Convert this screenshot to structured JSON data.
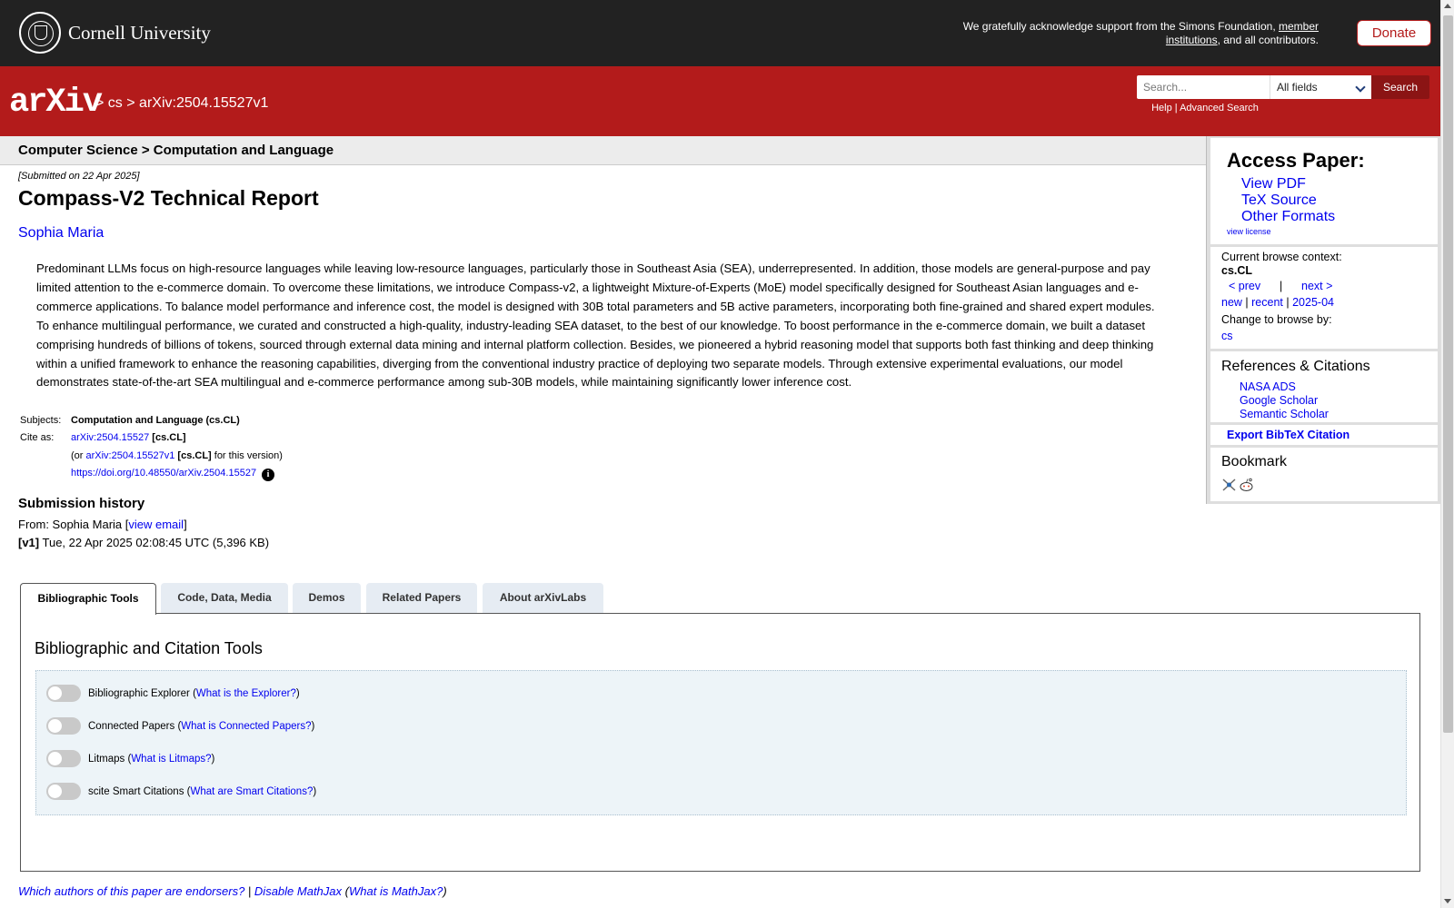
{
  "cornell": {
    "name": "Cornell University",
    "support_prefix": "We gratefully acknowledge support from the Simons Foundation, ",
    "support_link": "member institutions",
    "support_suffix": ", and all contributors.",
    "donate_label": "Donate"
  },
  "header": {
    "logo": "arXiv",
    "crumb_sep1": ">",
    "crumb_cs": "cs",
    "crumb_sep2": ">",
    "crumb_id": "arXiv:2504.15527v1",
    "search_placeholder": "Search...",
    "search_field": "All fields",
    "search_button": "Search",
    "help": "Help",
    "pipe": "|",
    "advanced": "Advanced Search"
  },
  "subheader": "Computer Science > Computation and Language",
  "paper": {
    "dateline": "[Submitted on 22 Apr 2025]",
    "title": "Compass-V2 Technical Report",
    "author": "Sophia Maria",
    "abstract": "Predominant LLMs focus on high-resource languages while leaving low-resource languages, particularly those in Southeast Asia (SEA), underrepresented. In addition, those models are general-purpose and pay limited attention to the e-commerce domain. To overcome these limitations, we introduce Compass-v2, a lightweight Mixture-of-Experts (MoE) model specifically designed for Southeast Asian languages and e-commerce applications. To balance model performance and inference cost, the model is designed with 30B total parameters and 5B active parameters, incorporating both fine-grained and shared expert modules. To enhance multilingual performance, we curated and constructed a high-quality, industry-leading SEA dataset, to the best of our knowledge. To boost performance in the e-commerce domain, we built a dataset comprising hundreds of billions of tokens, sourced through external data mining and internal platform collection. Besides, we pioneered a hybrid reasoning model that supports both fast thinking and deep thinking within a unified framework to enhance the reasoning capabilities, diverging from the conventional industry practice of deploying two separate models. Through extensive experimental evaluations, our model demonstrates state-of-the-art SEA multilingual and e-commerce performance among sub-30B models, while maintaining significantly lower inference cost."
  },
  "meta": {
    "subjects_label": "Subjects:",
    "subjects_value": "Computation and Language (cs.CL)",
    "cite_label": "Cite as:",
    "cite_id": "arXiv:2504.15527",
    "cite_cat": "[cs.CL]",
    "cite_or": "(or ",
    "cite_v_id": "arXiv:2504.15527v1",
    "cite_v_cat": "[cs.CL]",
    "cite_v_suffix": " for this version)",
    "doi": "https://doi.org/10.48550/arXiv.2504.15527",
    "info_glyph": "i"
  },
  "history": {
    "heading": "Submission history",
    "from_prefix": "From: Sophia Maria [",
    "view_email": "view email",
    "from_suffix": "]",
    "version_tag": "[v1]",
    "version_text": " Tue, 22 Apr 2025 02:08:45 UTC (5,396 KB)"
  },
  "tabs": [
    {
      "label": "Bibliographic Tools"
    },
    {
      "label": "Code, Data, Media"
    },
    {
      "label": "Demos"
    },
    {
      "label": "Related Papers"
    },
    {
      "label": "About arXivLabs"
    }
  ],
  "panel": {
    "title": "Bibliographic and Citation Tools",
    "tools": [
      {
        "name": "Bibliographic Explorer",
        "link": "What is the Explorer?"
      },
      {
        "name": "Connected Papers",
        "link": "What is Connected Papers?"
      },
      {
        "name": "Litmaps",
        "link": "What is Litmaps?"
      },
      {
        "name": "scite Smart Citations",
        "link": "What are Smart Citations?"
      }
    ]
  },
  "footer": {
    "endorsers": "Which authors of this paper are endorsers?",
    "sep": " | ",
    "mathjax": "Disable MathJax",
    "mathjax_help": "What is MathJax?"
  },
  "sidebar": {
    "access_title": "Access Paper:",
    "view_pdf": "View PDF",
    "tex_source": "TeX Source",
    "other_formats": "Other Formats",
    "view_license": "view license",
    "browse_context_label": "Current browse context:",
    "browse_context": "cs.CL",
    "prev": "< prev",
    "browse_sep": "|",
    "next": "next >",
    "new": "new",
    "recent": "recent",
    "month": "2025-04",
    "change_label": "Change to browse by:",
    "change_cs": "cs",
    "refs_title": "References & Citations",
    "nasa": "NASA ADS",
    "google": "Google Scholar",
    "semantic": "Semantic Scholar",
    "export_bibtex": "Export BibTeX Citation",
    "bookmark_title": "Bookmark"
  }
}
